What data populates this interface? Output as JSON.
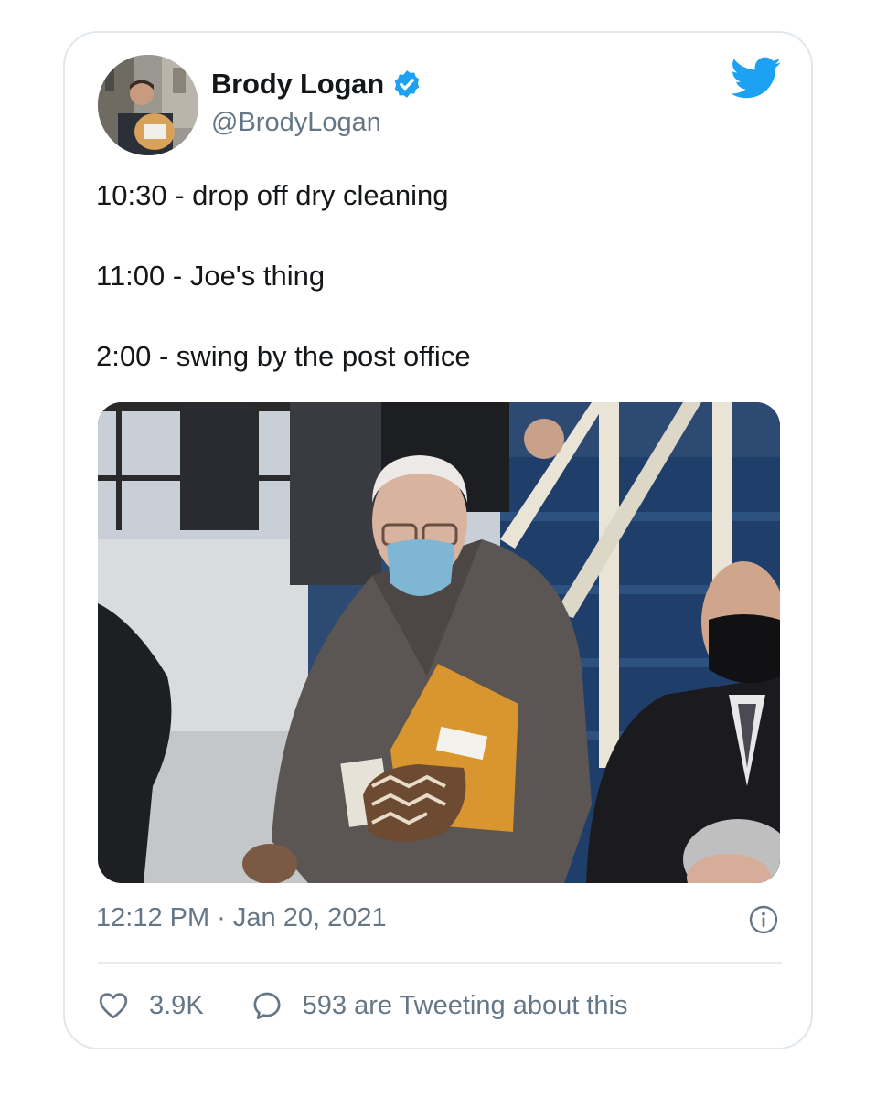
{
  "tweet": {
    "author": {
      "display_name": "Brody Logan",
      "handle": "@BrodyLogan",
      "verified": true
    },
    "lines": [
      "10:30 - drop off dry cleaning",
      "11:00 - Joe's thing",
      "2:00 - swing by the post office"
    ],
    "timestamp": "12:12 PM · Jan 20, 2021",
    "likes": "3.9K",
    "tweeting_about": "593 are Tweeting about this"
  },
  "icons": {
    "verified": "verified-badge-icon",
    "brand": "twitter-bird-icon",
    "info": "info-circle-icon",
    "like": "heart-icon",
    "reply": "speech-bubble-icon"
  },
  "colors": {
    "twitter_blue": "#1da1f2",
    "text_primary": "#14171a",
    "text_secondary": "#657786",
    "border": "#e1e8ed"
  }
}
